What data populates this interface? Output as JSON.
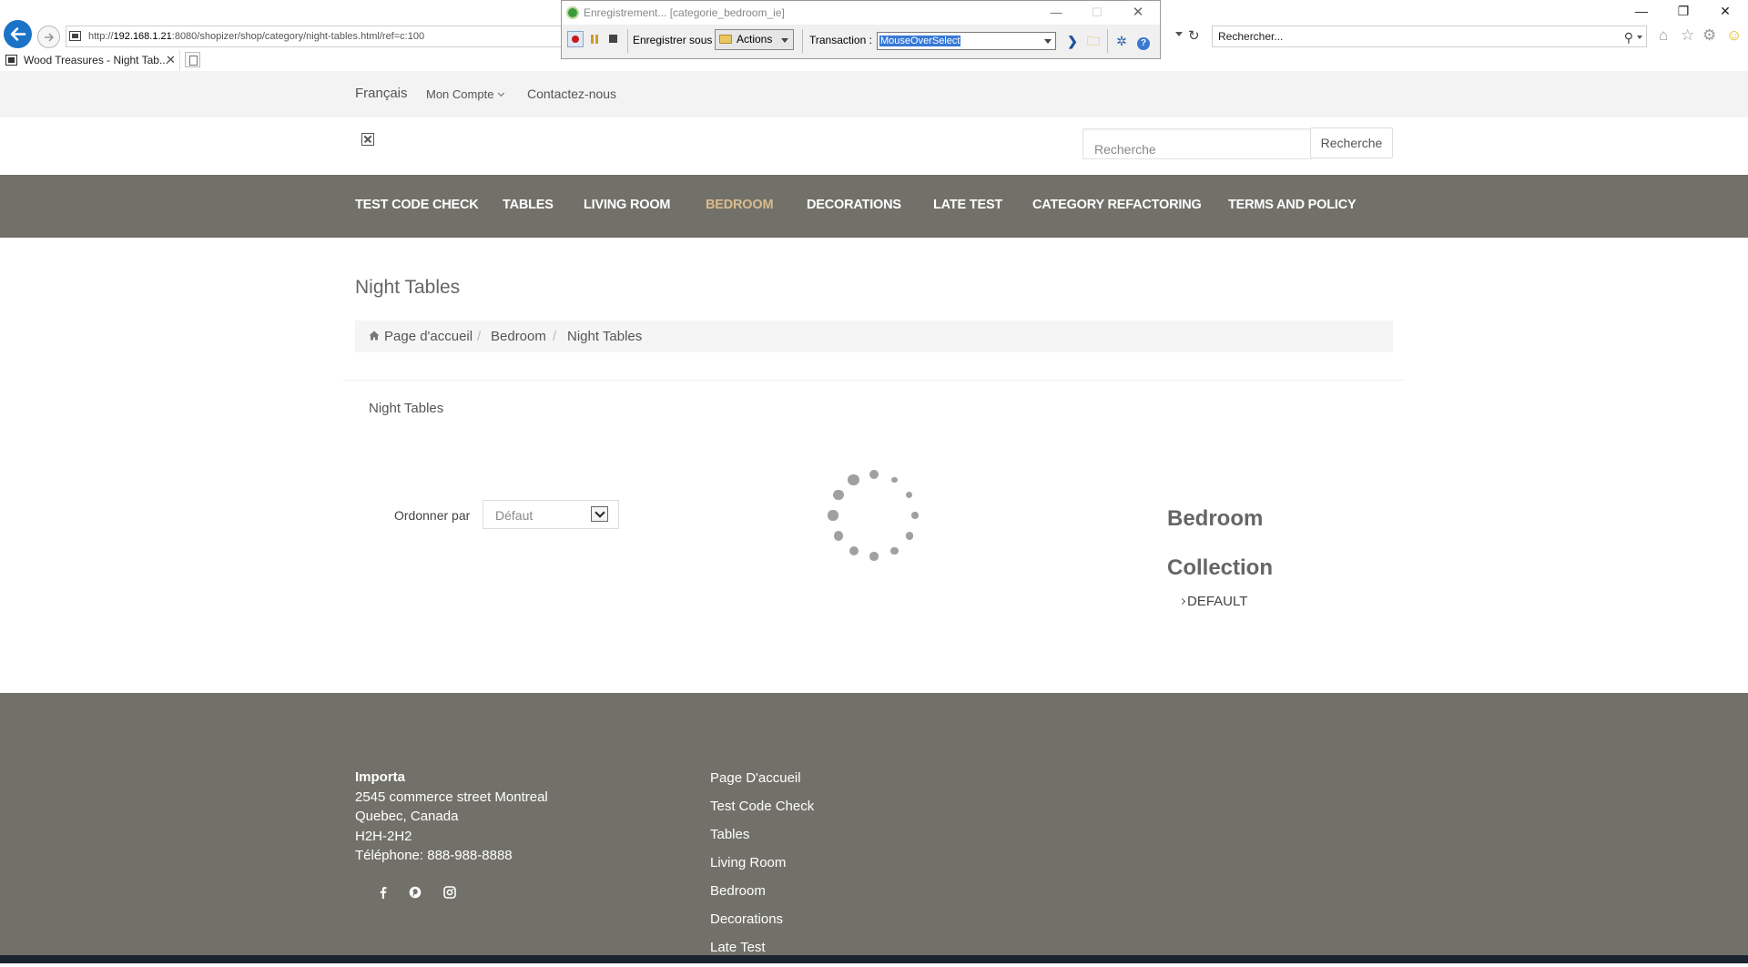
{
  "browser": {
    "url_prefix": "http://",
    "url_host": "192.168.1.21",
    "url_rest": ":8080/shopizer/shop/category/night-tables.html/ref=c:100",
    "search_placeholder": "Rechercher...",
    "tab_title": "Wood Treasures - Night Tab...",
    "tab_close": "✕",
    "window_controls": {
      "minimize": "—",
      "restore": "❐",
      "close": "✕"
    }
  },
  "recorder": {
    "title": "Enregistrement... [categorie_bedroom_ie]",
    "save_as_label": "Enregistrer sous :",
    "save_as_value": "Actions",
    "transaction_label": "Transaction :",
    "transaction_value": "MouseOverSelect",
    "window_controls": {
      "minimize": "—",
      "maximize": "☐",
      "close": "✕"
    }
  },
  "site": {
    "topbar": {
      "language": "Français",
      "account": "Mon Compte",
      "contact": "Contactez-nous"
    },
    "search": {
      "placeholder": "Recherche",
      "button": "Recherche"
    },
    "nav": [
      {
        "label": "TEST CODE CHECK",
        "active": false
      },
      {
        "label": "TABLES",
        "active": false
      },
      {
        "label": "LIVING ROOM",
        "active": false
      },
      {
        "label": "BEDROOM",
        "active": true
      },
      {
        "label": "DECORATIONS",
        "active": false
      },
      {
        "label": "LATE TEST",
        "active": false
      },
      {
        "label": "CATEGORY REFACTORING",
        "active": false
      },
      {
        "label": "TERMS AND POLICY",
        "active": false
      }
    ],
    "page_title": "Night Tables",
    "breadcrumb": [
      "Page d'accueil",
      "Bedroom",
      "Night Tables"
    ],
    "breadcrumb_sep": "/",
    "category_label": "Night Tables",
    "sort": {
      "label": "Ordonner par",
      "value": "Défaut"
    },
    "sidebar": {
      "title_line1": "Bedroom",
      "title_line2": "Collection",
      "link": "DEFAULT"
    },
    "footer": {
      "company": "Importa",
      "address_lines": [
        "2545 commerce street Montreal",
        "Quebec, Canada",
        "H2H-2H2",
        "Téléphone: 888-988-8888"
      ],
      "links": [
        "Page D'accueil",
        "Test Code Check",
        "Tables",
        "Living Room",
        "Bedroom",
        "Decorations",
        "Late Test"
      ],
      "social_icons": [
        "facebook-icon",
        "pinterest-icon",
        "instagram-icon"
      ]
    }
  },
  "colors": {
    "nav_bg": "#727169",
    "nav_active": "#d9bb8f",
    "ie_blue": "#1a73c7"
  }
}
